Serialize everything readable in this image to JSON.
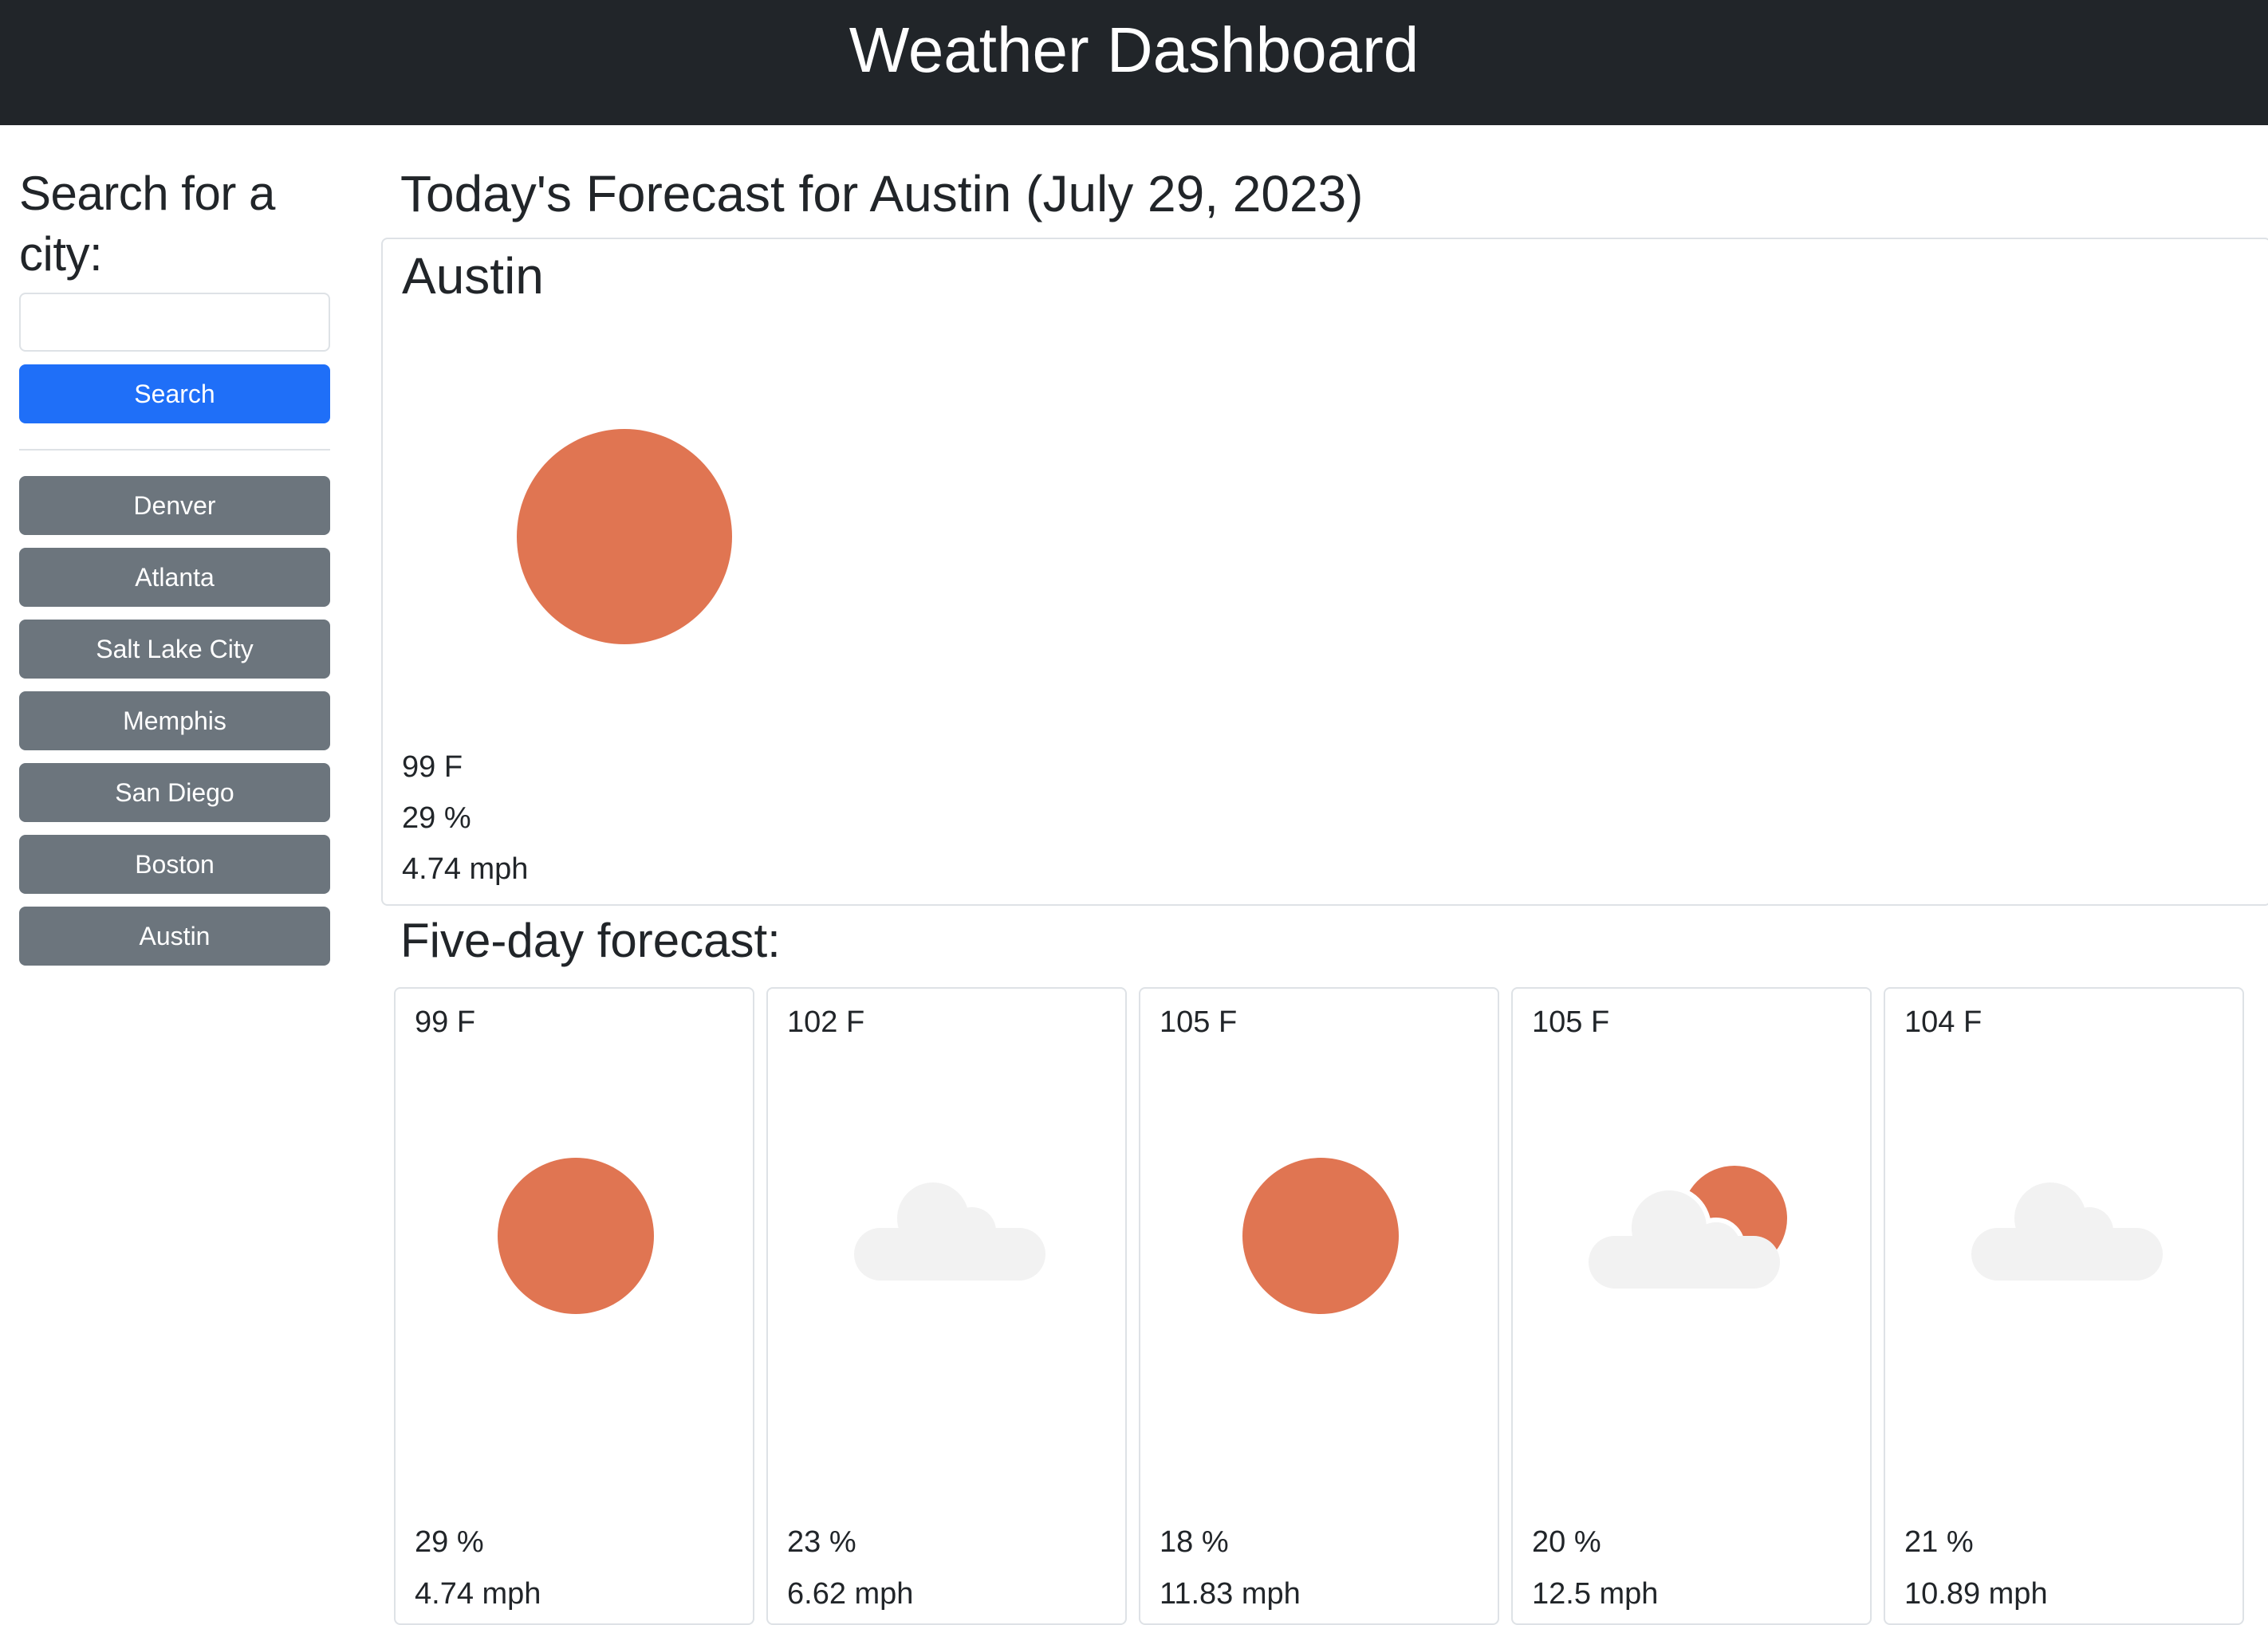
{
  "header": {
    "title": "Weather Dashboard"
  },
  "sidebar": {
    "heading": "Search for a city:",
    "search": {
      "value": "",
      "placeholder": ""
    },
    "search_button": "Search",
    "history": [
      "Denver",
      "Atlanta",
      "Salt Lake City",
      "Memphis",
      "San Diego",
      "Boston",
      "Austin"
    ]
  },
  "main": {
    "title": "Today's Forecast for Austin (July 29, 2023)",
    "today": {
      "city": "Austin",
      "icon": "sun-icon",
      "temp": "99 F",
      "humidity": "29 %",
      "wind": "4.74 mph"
    },
    "five_day_title": "Five-day forecast:",
    "forecast": [
      {
        "temp": "99 F",
        "icon": "sun-icon",
        "humidity": "29 %",
        "wind": "4.74 mph"
      },
      {
        "temp": "102 F",
        "icon": "cloud-icon",
        "humidity": "23 %",
        "wind": "6.62 mph"
      },
      {
        "temp": "105 F",
        "icon": "sun-icon",
        "humidity": "18 %",
        "wind": "11.83 mph"
      },
      {
        "temp": "105 F",
        "icon": "partly-cloudy-icon",
        "humidity": "20 %",
        "wind": "12.5 mph"
      },
      {
        "temp": "104 F",
        "icon": "cloud-icon",
        "humidity": "21 %",
        "wind": "10.89 mph"
      }
    ]
  },
  "colors": {
    "header_bg": "#212529",
    "primary": "#1f6ff8",
    "secondary": "#6c757d",
    "sun": "#e07552",
    "cloud": "#f2f2f2",
    "border": "#dee2e6"
  }
}
